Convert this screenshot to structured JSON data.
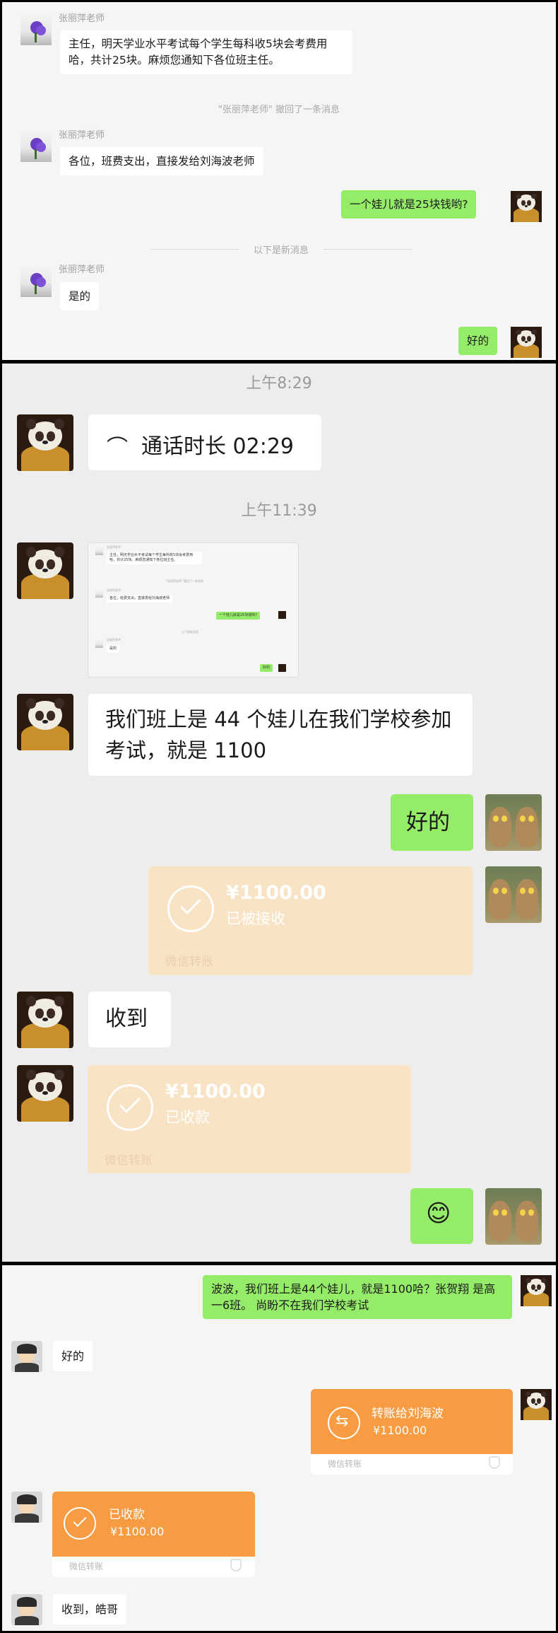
{
  "panel1": {
    "sender_name": "张丽萍老师",
    "msg1": "主任，明天学业水平考试每个学生每科收5块会考费用哈，共计25块。麻烦您通知下各位班主任。",
    "recall_notice": "\"张丽萍老师\" 撤回了一条消息",
    "msg2": "各位，班费支出，直接发给刘海波老师",
    "my_msg1": "一个娃儿就是25块钱哟?",
    "new_msgs_divider": "以下是新消息",
    "msg3": "是的",
    "my_msg2": "好的"
  },
  "panel2": {
    "time1": "上午8:29",
    "call_duration": "通话时长 02:29",
    "time2": "上午11:39",
    "thumbnail": {
      "sender": "张丽萍老师",
      "msg1": "主任，明天学业水平考试每个学生每科收5块会考费用哈，共计25块。麻烦您通知下各位班主任。",
      "recall": "\"张丽萍老师\" 撤回了一条消息",
      "msg2": "各位，班费支出，直接发给刘海波老师",
      "my1": "一个娃儿就是25块钱哟?",
      "divider": "以下是新消息",
      "msg3": "是的",
      "my2": "好的"
    },
    "msg_class": "我们班上是 44 个娃儿在我们学校参加考试，就是 1100",
    "reply_ok": "好的",
    "transfer_received": {
      "amount": "¥1100.00",
      "status": "已被接收",
      "footer": "微信转账"
    },
    "msg_received": "收到",
    "transfer_collected": {
      "amount": "¥1100.00",
      "status": "已收款",
      "footer": "微信转账"
    },
    "emoji": "😊"
  },
  "panel3": {
    "my_msg": "波波，我们班上是44个娃儿，就是1100哈？张贺翔 是高一6班。 尚盼不在我们学校考试",
    "reply_ok": "好的",
    "transfer_out": {
      "title": "转账给刘海波",
      "amount": "¥1100.00",
      "footer": "微信转账"
    },
    "transfer_in": {
      "title": "已收款",
      "amount": "¥1100.00",
      "footer": "微信转账"
    },
    "final_msg": "收到，皓哥"
  },
  "colors": {
    "green_bubble": "#95ec69",
    "transfer_orange": "#f79c42",
    "transfer_faded": "#f9e3c5"
  }
}
